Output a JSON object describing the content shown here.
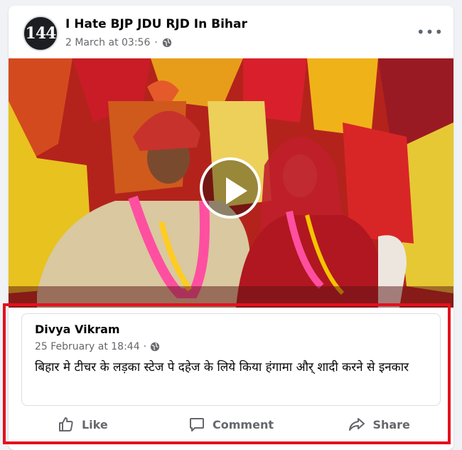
{
  "post": {
    "page_name": "I Hate BJP JDU RJD In Bihar",
    "avatar_text": "144",
    "timestamp": "2 March at 03:56",
    "separator": "·",
    "privacy_icon": "globe-icon",
    "more_label": "•••"
  },
  "video": {
    "play_icon": "play-icon"
  },
  "shared_post": {
    "author": "Divya Vikram",
    "timestamp": "25 February at 18:44",
    "separator": "·",
    "privacy_icon": "globe-icon",
    "text": "बिहार मे टीचर के लड़का स्टेज पे दहेज के लिये किया हंगामा और् शादी करने से इनकार"
  },
  "actions": {
    "like": "Like",
    "comment": "Comment",
    "share": "Share"
  },
  "colors": {
    "highlight": "#e5101c",
    "meta_text": "#65676b",
    "primary_text": "#050505",
    "background": "#f0f2f5"
  }
}
